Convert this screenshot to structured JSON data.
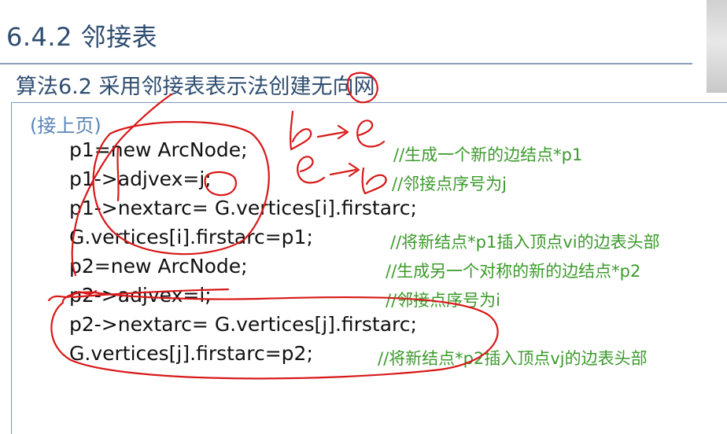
{
  "header": {
    "section_title": "6.4.2 邻接表",
    "algorithm_title": "算法6.2 采用邻接表表示法创建无向网"
  },
  "content": {
    "continued_label": "(接上页)",
    "code_lines": [
      {
        "code": "p1=new ArcNode;",
        "comment": "//生成一个新的边结点*p1"
      },
      {
        "code": "p1->adjvex=j;",
        "comment": "//邻接点序号为j"
      },
      {
        "code": "p1->nextarc= G.vertices[i].firstarc;",
        "comment": ""
      },
      {
        "code": "G.vertices[i].firstarc=p1;",
        "comment": "//将新结点*p1插入顶点vi的边表头部"
      },
      {
        "code": "p2=new ArcNode;",
        "comment": "//生成另一个对称的新的边结点*p2"
      },
      {
        "code": "p2->adjvex=i;",
        "comment": "//邻接点序号为i"
      },
      {
        "code": "p2->nextarc= G.vertices[j].firstarc;",
        "comment": ""
      },
      {
        "code": "G.vertices[j].firstarc=p2;",
        "comment": "//将新结点*p2插入顶点vj的边表头部"
      }
    ]
  },
  "annotations": {
    "handwritten_1": "b->e",
    "handwritten_2": "e->b",
    "ink_color": "#d81818"
  },
  "colors": {
    "title": "#2e4d70",
    "comment": "#3c9a2c",
    "continued": "#5a84b8",
    "code": "#111111"
  }
}
